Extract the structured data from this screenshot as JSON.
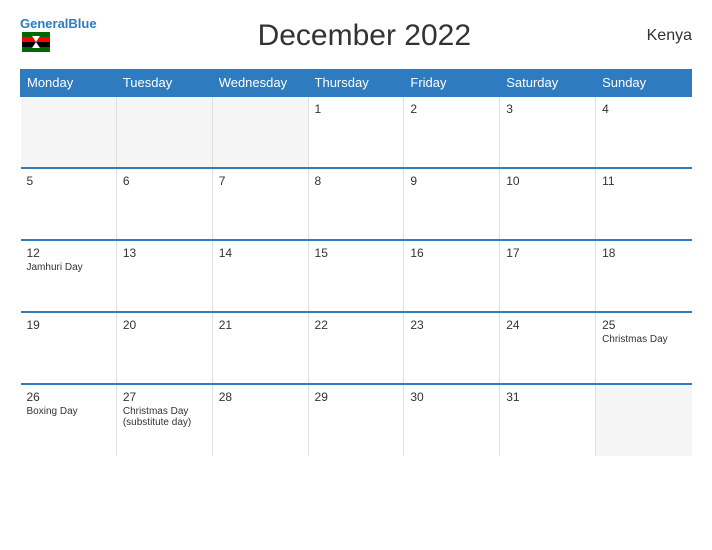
{
  "header": {
    "logo_general": "General",
    "logo_blue": "Blue",
    "title": "December 2022",
    "country": "Kenya"
  },
  "columns": [
    "Monday",
    "Tuesday",
    "Wednesday",
    "Thursday",
    "Friday",
    "Saturday",
    "Sunday"
  ],
  "weeks": [
    [
      {
        "num": "",
        "holiday": "",
        "empty": true
      },
      {
        "num": "",
        "holiday": "",
        "empty": true
      },
      {
        "num": "",
        "holiday": "",
        "empty": true
      },
      {
        "num": "1",
        "holiday": ""
      },
      {
        "num": "2",
        "holiday": ""
      },
      {
        "num": "3",
        "holiday": ""
      },
      {
        "num": "4",
        "holiday": ""
      }
    ],
    [
      {
        "num": "5",
        "holiday": ""
      },
      {
        "num": "6",
        "holiday": ""
      },
      {
        "num": "7",
        "holiday": ""
      },
      {
        "num": "8",
        "holiday": ""
      },
      {
        "num": "9",
        "holiday": ""
      },
      {
        "num": "10",
        "holiday": ""
      },
      {
        "num": "11",
        "holiday": ""
      }
    ],
    [
      {
        "num": "12",
        "holiday": "Jamhuri Day"
      },
      {
        "num": "13",
        "holiday": ""
      },
      {
        "num": "14",
        "holiday": ""
      },
      {
        "num": "15",
        "holiday": ""
      },
      {
        "num": "16",
        "holiday": ""
      },
      {
        "num": "17",
        "holiday": ""
      },
      {
        "num": "18",
        "holiday": ""
      }
    ],
    [
      {
        "num": "19",
        "holiday": ""
      },
      {
        "num": "20",
        "holiday": ""
      },
      {
        "num": "21",
        "holiday": ""
      },
      {
        "num": "22",
        "holiday": ""
      },
      {
        "num": "23",
        "holiday": ""
      },
      {
        "num": "24",
        "holiday": ""
      },
      {
        "num": "25",
        "holiday": "Christmas Day"
      }
    ],
    [
      {
        "num": "26",
        "holiday": "Boxing Day"
      },
      {
        "num": "27",
        "holiday": "Christmas Day (substitute day)"
      },
      {
        "num": "28",
        "holiday": ""
      },
      {
        "num": "29",
        "holiday": ""
      },
      {
        "num": "30",
        "holiday": ""
      },
      {
        "num": "31",
        "holiday": ""
      },
      {
        "num": "",
        "holiday": "",
        "empty": true
      }
    ]
  ]
}
